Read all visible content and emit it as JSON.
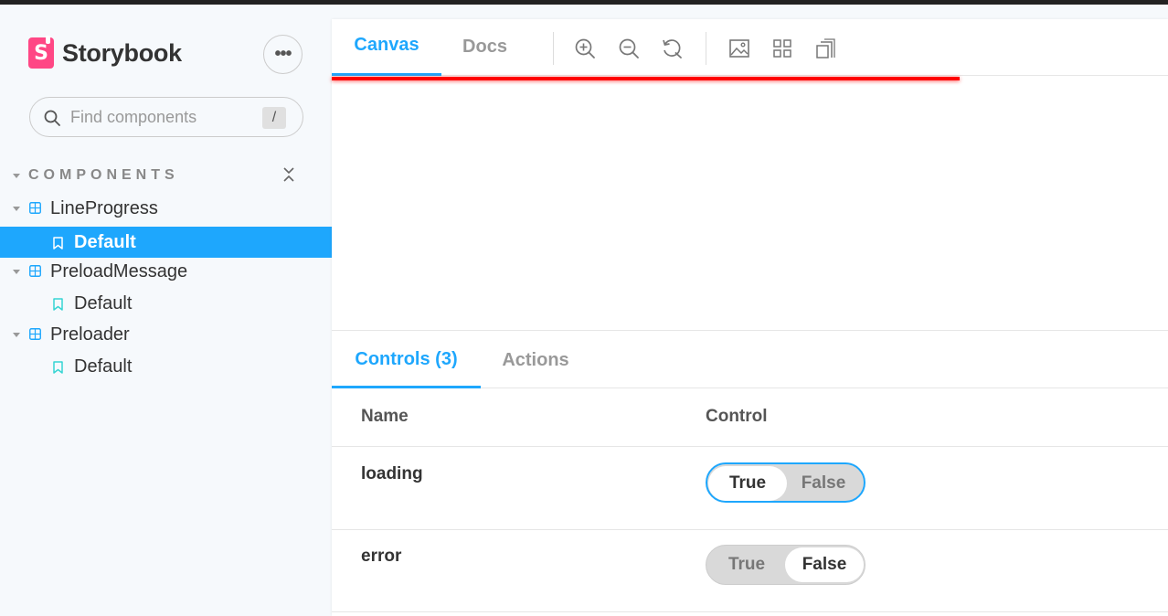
{
  "sidebar": {
    "brand": "Storybook",
    "menu_label": "•••",
    "search": {
      "placeholder": "Find components",
      "shortcut": "/"
    },
    "section_label": "COMPONENTS",
    "tree": [
      {
        "component": "LineProgress",
        "story": "Default",
        "selected": true
      },
      {
        "component": "PreloadMessage",
        "story": "Default",
        "selected": false
      },
      {
        "component": "Preloader",
        "story": "Default",
        "selected": false
      }
    ]
  },
  "toolbar": {
    "tabs": [
      {
        "label": "Canvas",
        "active": true
      },
      {
        "label": "Docs",
        "active": false
      }
    ],
    "tools": [
      "zoom-in-icon",
      "zoom-out-icon",
      "reset-zoom-icon",
      "background-icon",
      "grid-icon",
      "viewport-icon"
    ]
  },
  "canvas": {
    "line_progress_color": "#ff0000"
  },
  "addons": {
    "tabs": [
      {
        "label": "Controls (3)",
        "active": true
      },
      {
        "label": "Actions",
        "active": false
      }
    ],
    "columns": {
      "name": "Name",
      "control": "Control"
    },
    "rows": [
      {
        "name": "loading",
        "true_label": "True",
        "false_label": "False",
        "value": true
      },
      {
        "name": "error",
        "true_label": "True",
        "false_label": "False",
        "value": false
      }
    ]
  },
  "colors": {
    "accent": "#1ea7fd",
    "brand": "#ff4785"
  }
}
